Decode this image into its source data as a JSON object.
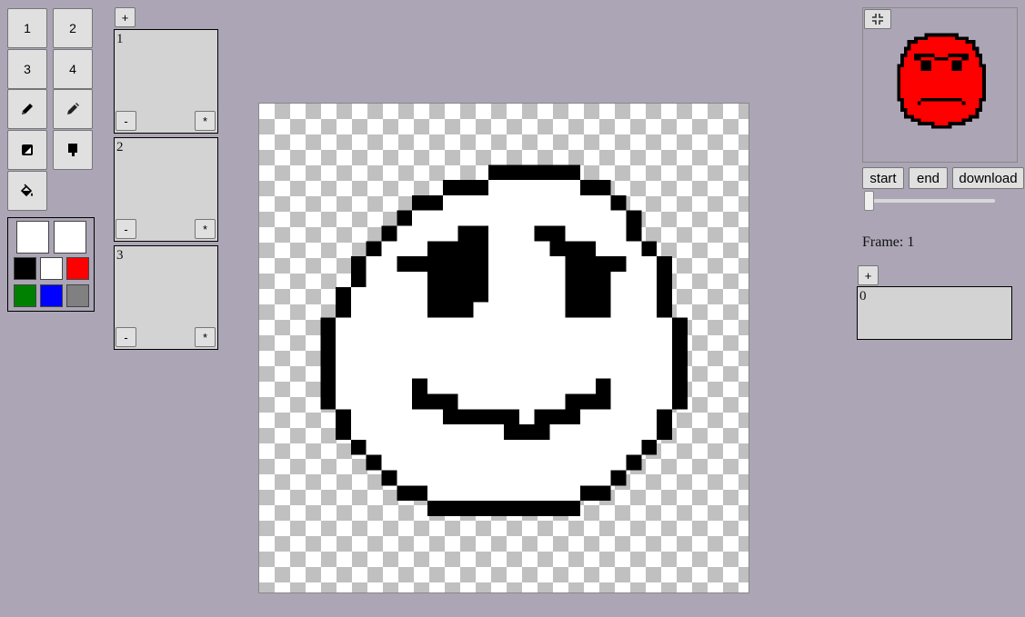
{
  "brush_sizes": [
    "1",
    "2",
    "3",
    "4"
  ],
  "tools": [
    {
      "icon": "pencil-icon"
    },
    {
      "icon": "pen-icon"
    },
    {
      "icon": "eraser-icon"
    },
    {
      "icon": "brush-icon"
    },
    {
      "icon": "paint-bucket-icon"
    }
  ],
  "selected_colors": {
    "primary": "#ffffff",
    "secondary": "#ffffff"
  },
  "palette": [
    "#000000",
    "#ffffff",
    "#ff0000",
    "#008000",
    "#0000ff",
    "#808080"
  ],
  "layers": {
    "add_label": "+",
    "items": [
      {
        "number": "1",
        "remove_label": "-",
        "duplicate_label": "*"
      },
      {
        "number": "2",
        "remove_label": "-",
        "duplicate_label": "*"
      },
      {
        "number": "3",
        "remove_label": "-",
        "duplicate_label": "*"
      }
    ]
  },
  "canvas": {
    "checker_light": "#ffffff",
    "checker_dark": "#c0c0c0"
  },
  "preview": {
    "collapse_icon": "collapse-icon",
    "face_color": "#ff0000"
  },
  "animation": {
    "start_label": "start",
    "end_label": "end",
    "download_label": "download",
    "frame_label": "Frame: 1",
    "slider_fraction": 0.0,
    "add_frame_label": "+",
    "frames": [
      {
        "number": "0"
      }
    ]
  }
}
